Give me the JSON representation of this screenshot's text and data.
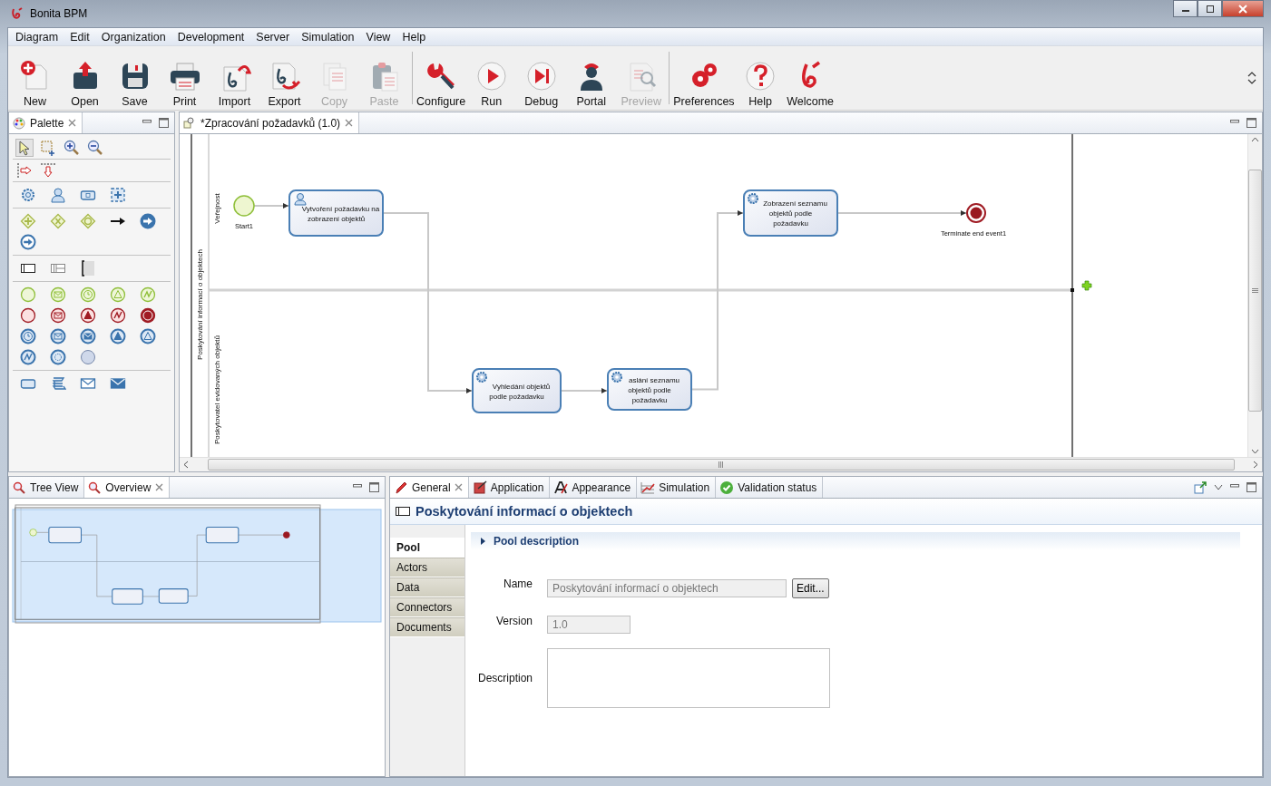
{
  "window": {
    "title": "Bonita BPM"
  },
  "menu": [
    "Diagram",
    "Edit",
    "Organization",
    "Development",
    "Server",
    "Simulation",
    "View",
    "Help"
  ],
  "toolbar": [
    {
      "items": [
        {
          "label": "New",
          "disabled": false
        },
        {
          "label": "Open",
          "disabled": false
        },
        {
          "label": "Save",
          "disabled": false
        },
        {
          "label": "Print",
          "disabled": false
        },
        {
          "label": "Import",
          "disabled": false
        },
        {
          "label": "Export",
          "disabled": false
        },
        {
          "label": "Copy",
          "disabled": true
        },
        {
          "label": "Paste",
          "disabled": true
        }
      ]
    },
    {
      "items": [
        {
          "label": "Configure",
          "disabled": false
        },
        {
          "label": "Run",
          "disabled": false
        },
        {
          "label": "Debug",
          "disabled": false
        },
        {
          "label": "Portal",
          "disabled": false
        },
        {
          "label": "Preview",
          "disabled": true
        }
      ]
    },
    {
      "items": [
        {
          "label": "Preferences",
          "disabled": false
        },
        {
          "label": "Help",
          "disabled": false
        },
        {
          "label": "Welcome",
          "disabled": false
        }
      ]
    }
  ],
  "palette": {
    "title": "Palette"
  },
  "editor": {
    "tab": "*Zpracování požadavků (1.0)",
    "pool": {
      "label": "Poskytování informací o objektech",
      "lanes": [
        {
          "label": "Veřejnost"
        },
        {
          "label": "Poskytovatel evidovaných objektů"
        }
      ]
    },
    "nodes": [
      {
        "kind": "start",
        "label": "Start1"
      },
      {
        "kind": "user_task",
        "lines": [
          "Vytvoření požadavku na",
          "zobrazení objektů"
        ]
      },
      {
        "kind": "service_task",
        "lines": [
          "Vyhledání objektů",
          "podle požadavku"
        ]
      },
      {
        "kind": "service_task",
        "lines": [
          "aslání seznamu",
          "objektů podle",
          "požadavku"
        ]
      },
      {
        "kind": "service_task",
        "lines": [
          "Zobrazení seznamu",
          "objektů podle",
          "požadavku"
        ]
      },
      {
        "kind": "end",
        "label": "Terminate end event1"
      }
    ]
  },
  "bottom_left": {
    "tabs": [
      {
        "label": "Tree View",
        "selected": false
      },
      {
        "label": "Overview",
        "selected": true
      }
    ]
  },
  "properties": {
    "tabs": [
      {
        "label": "General",
        "selected": true
      },
      {
        "label": "Application",
        "selected": false
      },
      {
        "label": "Appearance",
        "selected": false
      },
      {
        "label": "Simulation",
        "selected": false
      },
      {
        "label": "Validation status",
        "selected": false
      }
    ],
    "title": "Poskytování informací o objektech",
    "side_tabs": [
      {
        "label": "Pool",
        "selected": true
      },
      {
        "label": "Actors",
        "selected": false
      },
      {
        "label": "Data",
        "selected": false
      },
      {
        "label": "Connectors",
        "selected": false
      },
      {
        "label": "Documents",
        "selected": false
      }
    ],
    "section": {
      "title": "Pool description",
      "expanded": false
    },
    "name": {
      "label": "Name",
      "value": "Poskytování informací o objektech",
      "disabled": true
    },
    "edit_button": "Edit...",
    "version": {
      "label": "Version",
      "value": "1.0",
      "disabled": true
    },
    "description": {
      "label": "Description"
    }
  }
}
